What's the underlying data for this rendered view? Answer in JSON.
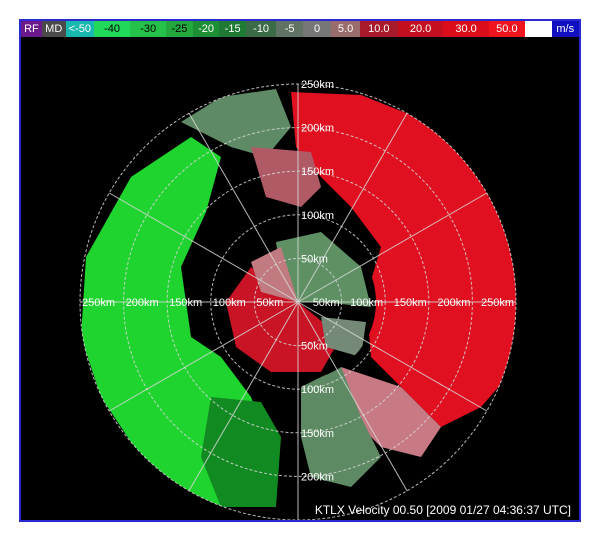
{
  "colorbar": [
    {
      "label": "RF",
      "color": "#6b1a8c",
      "text": "#ffffff"
    },
    {
      "label": "MD",
      "color": "#4a4a4a",
      "text": "#ffffff"
    },
    {
      "label": "<-50",
      "color": "#18b8b0",
      "text": "#ffffff"
    },
    {
      "label": "-40",
      "color": "#22d85a",
      "text": "#000000"
    },
    {
      "label": "-30",
      "color": "#25c24a",
      "text": "#000000"
    },
    {
      "label": "-25",
      "color": "#22a83c",
      "text": "#000000"
    },
    {
      "label": "-20",
      "color": "#1d8e33",
      "text": "#ffffff"
    },
    {
      "label": "-15",
      "color": "#1f7a34",
      "text": "#ffffff"
    },
    {
      "label": "-10",
      "color": "#3c6b48",
      "text": "#ffffff"
    },
    {
      "label": "-5",
      "color": "#617362",
      "text": "#ffffff"
    },
    {
      "label": "0",
      "color": "#777777",
      "text": "#ffffff"
    },
    {
      "label": "5.0",
      "color": "#9b6c6c",
      "text": "#ffffff"
    },
    {
      "label": "10.0",
      "color": "#a81a2a",
      "text": "#ffffff"
    },
    {
      "label": "20.0",
      "color": "#c4101e",
      "text": "#ffffff"
    },
    {
      "label": "30.0",
      "color": "#db0d1b",
      "text": "#ffffff"
    },
    {
      "label": "50.0",
      "color": "#f0141e",
      "text": "#ffffff"
    },
    {
      "label": "",
      "color": "#ffffff",
      "text": "#000000"
    },
    {
      "label": "m/s",
      "color": "#1010c0",
      "text": "#ffffff"
    }
  ],
  "range_rings": {
    "north": [
      "250km",
      "200km",
      "150km",
      "100km",
      "50km"
    ],
    "south": [
      "50km",
      "100km",
      "150km",
      "200km"
    ],
    "west": [
      "250km",
      "200km",
      "150km",
      "100km",
      "50km"
    ],
    "east": [
      "50km",
      "100km",
      "150km",
      "200km",
      "250km"
    ]
  },
  "caption": "KTLX Velocity 00.50 [2009 01/27 04:36:37 UTC]",
  "colors": {
    "inbound_green": "#1fd42f",
    "dark_green": "#158a22",
    "outbound_red": "#e01020",
    "dark_red": "#a8101e",
    "pink": "#c87a84",
    "grey_green": "#6f9a74"
  }
}
